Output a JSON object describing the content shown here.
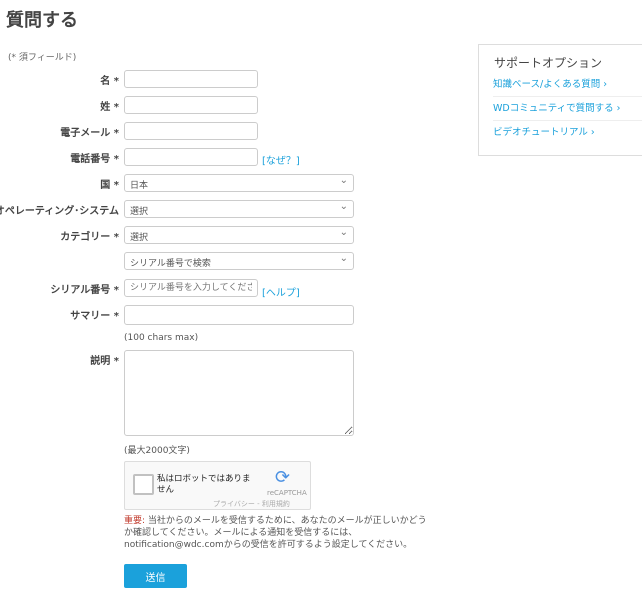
{
  "title": "質問する",
  "required_note": "(* 須フィールド)",
  "fields": {
    "first_name": {
      "label": "名 *",
      "value": ""
    },
    "last_name": {
      "label": "姓 *",
      "value": ""
    },
    "email": {
      "label": "電子メール *",
      "value": ""
    },
    "phone": {
      "label": "電話番号 *",
      "value": "",
      "link": "[なぜ？]"
    },
    "country": {
      "label": "国 *",
      "value": "日本"
    },
    "os": {
      "label": "オペレーティング･システム",
      "value": "選択"
    },
    "category": {
      "label": "カテゴリー *",
      "value": "選択"
    },
    "search_by": {
      "value": "シリアル番号で検索"
    },
    "serial": {
      "label": "シリアル番号 *",
      "placeholder": "シリアル番号を入力してください",
      "link": "[ヘルプ]"
    },
    "summary": {
      "label": "サマリー *",
      "value": "",
      "hint": "(100 chars max)"
    },
    "description": {
      "label": "説明 *",
      "value": "",
      "hint": "(最大2000文字)"
    }
  },
  "captcha": {
    "label": "私はロボットではありません",
    "brand": "reCAPTCHA",
    "links": "プライバシー - 利用規約"
  },
  "important": {
    "prefix": "重要:",
    "text": " 当社からのメールを受信するために、あなたのメールが正しいかどうか確認してください。メールによる通知を受信するには、notification@wdc.comからの受信を許可するよう設定してください。"
  },
  "submit": "送信",
  "sidebar": {
    "title": "サポートオプション",
    "items": [
      "知識ベース/よくある質問 ›",
      "WDコミュニティで質問する ›",
      "ビデオチュートリアル ›"
    ]
  },
  "colors": {
    "accent": "#1ba1db",
    "important": "#c0392b"
  }
}
